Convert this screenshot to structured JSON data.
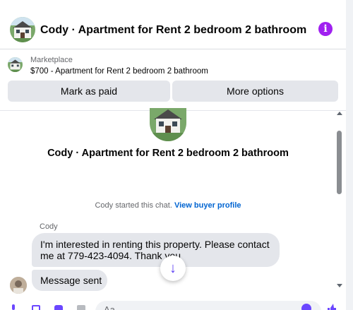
{
  "header": {
    "title": "Cody · Apartment for Rent 2 bedroom 2 bathroom",
    "info_glyph": "i"
  },
  "listing": {
    "category": "Marketplace",
    "price_title": "$700 - Apartment for Rent 2 bedroom 2 bathroom",
    "mark_paid_label": "Mark as paid",
    "more_options_label": "More options"
  },
  "chat": {
    "title": "Cody · Apartment for Rent 2 bedroom 2 bathroom",
    "started_text": "Cody started this chat.",
    "view_profile_label": "View buyer profile",
    "sender_name": "Cody",
    "messages": [
      "I'm interested in renting this property. Please contact me at 779-423-4094. Thank you",
      "Message sent"
    ],
    "scroll_down_glyph": "↓"
  },
  "composer": {
    "placeholder": "Aa"
  },
  "colors": {
    "accent": "#a020f0",
    "link": "#0064d1",
    "bubble": "#e4e6eb",
    "button": "#e4e6eb"
  },
  "icons": [
    "house-thumbnail",
    "info-icon",
    "arrow-down-icon",
    "mic-icon",
    "gallery-icon",
    "sticker-icon",
    "gif-icon",
    "emoji-icon",
    "like-icon"
  ]
}
